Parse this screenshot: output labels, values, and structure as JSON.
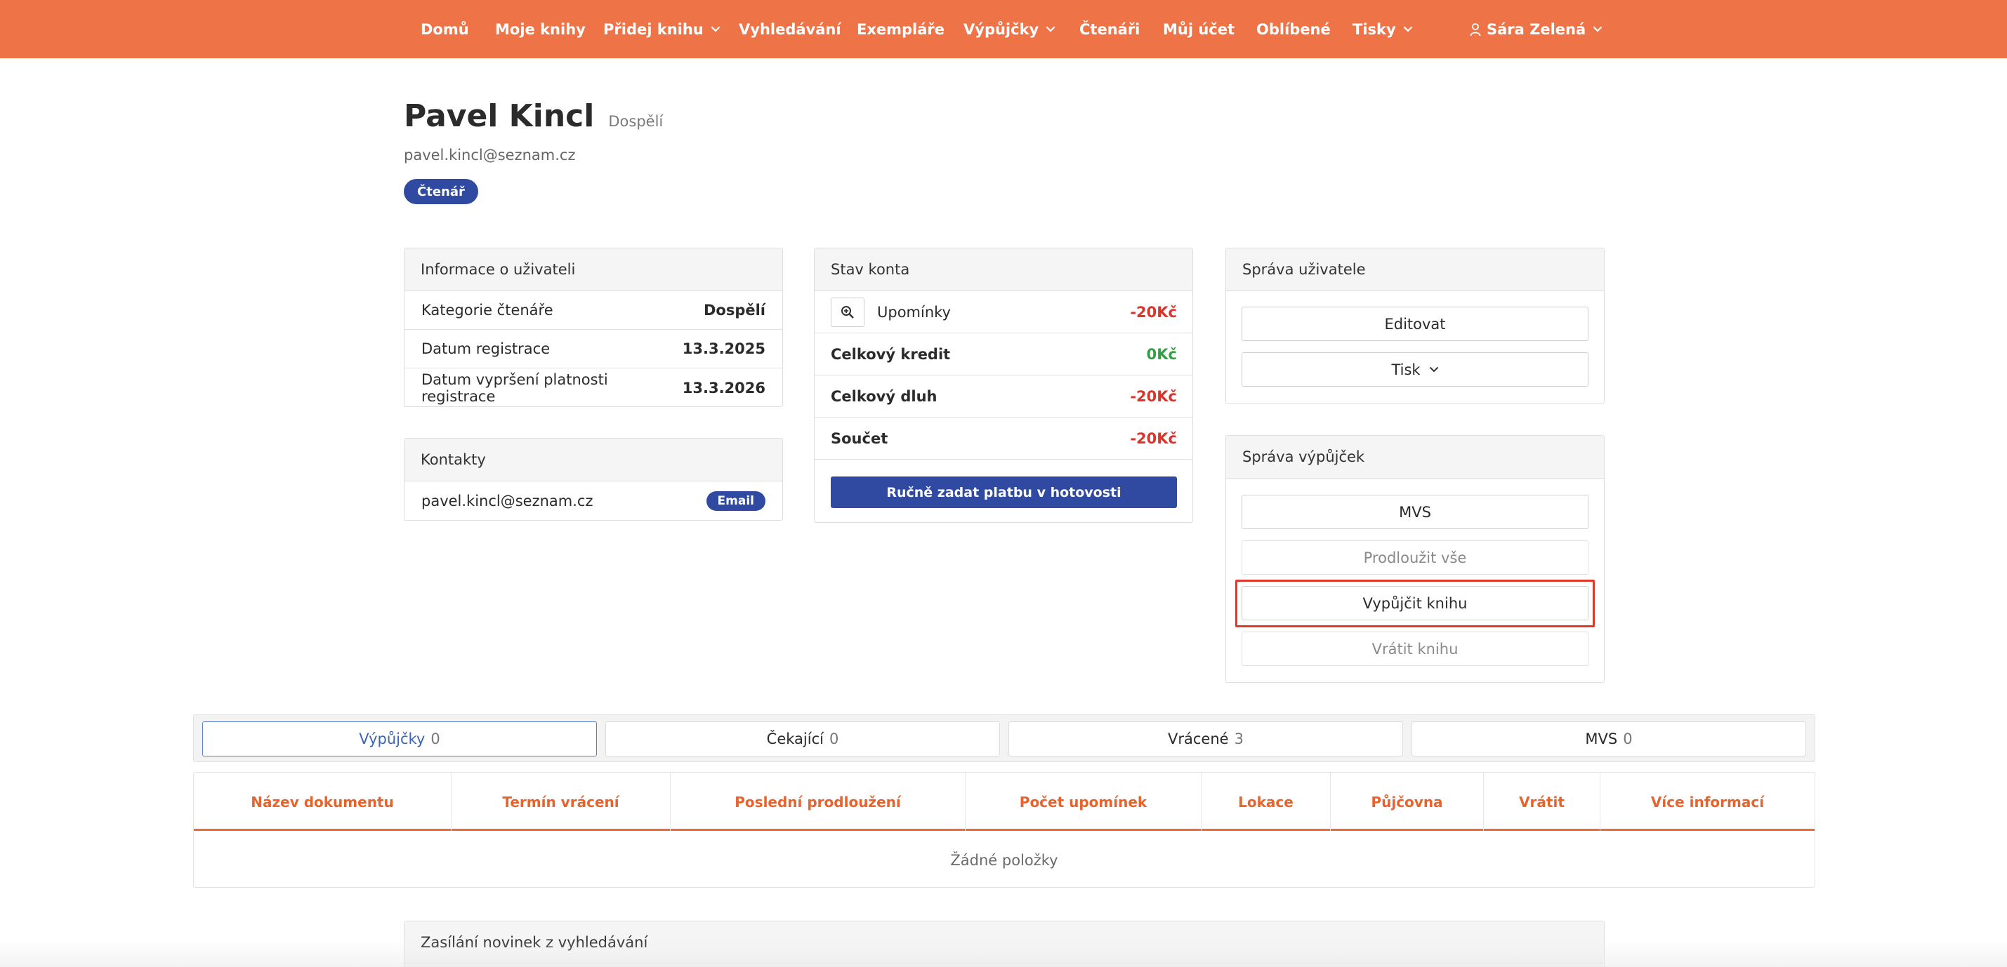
{
  "nav": {
    "items": [
      {
        "label": "Domů",
        "dropdown": false
      },
      {
        "label": "Moje knihy",
        "dropdown": false
      },
      {
        "label": "Přidej knihu",
        "dropdown": true
      },
      {
        "label": "Vyhledávání",
        "dropdown": false
      },
      {
        "label": "Exempláře",
        "dropdown": false
      },
      {
        "label": "Výpůjčky",
        "dropdown": true
      },
      {
        "label": "Čtenáři",
        "dropdown": false
      },
      {
        "label": "Můj účet",
        "dropdown": false
      },
      {
        "label": "Oblíbené",
        "dropdown": false
      },
      {
        "label": "Tisky",
        "dropdown": true
      }
    ],
    "user": "Sára Zelená",
    "color": "#ee7448"
  },
  "profile": {
    "name": "Pavel Kincl",
    "category": "Dospělí",
    "email": "pavel.kincl@seznam.cz",
    "role_badge": "Čtenář"
  },
  "user_info": {
    "title": "Informace o uživateli",
    "rows": [
      {
        "label": "Kategorie čtenáře",
        "value": "Dospělí"
      },
      {
        "label": "Datum registrace",
        "value": "13.3.2025"
      },
      {
        "label": "Datum vypršení platnosti registrace",
        "value": "13.3.2026"
      }
    ]
  },
  "contacts": {
    "title": "Kontakty",
    "email": "pavel.kincl@seznam.cz",
    "badge": "Email"
  },
  "account": {
    "title": "Stav konta",
    "reminders_label": "Upomínky",
    "reminders_value": "-20Kč",
    "credit_label": "Celkový kredit",
    "credit_value": "0Kč",
    "debt_label": "Celkový dluh",
    "debt_value": "-20Kč",
    "sum_label": "Součet",
    "sum_value": "-20Kč",
    "pay_button": "Ručně zadat platbu v hotovosti"
  },
  "user_admin": {
    "title": "Správa uživatele",
    "edit": "Editovat",
    "print": "Tisk"
  },
  "loans_admin": {
    "title": "Správa výpůjček",
    "mvs": "MVS",
    "extend_all": "Prodloužit vše",
    "borrow": "Vypůjčit knihu",
    "return": "Vrátit knihu"
  },
  "tabs": [
    {
      "label": "Výpůjčky",
      "count": "0",
      "active": true
    },
    {
      "label": "Čekající",
      "count": "0",
      "active": false
    },
    {
      "label": "Vrácené",
      "count": "3",
      "active": false
    },
    {
      "label": "MVS",
      "count": "0",
      "active": false
    }
  ],
  "table": {
    "columns": [
      "Název dokumentu",
      "Termín vrácení",
      "Poslední prodloužení",
      "Počet upomínek",
      "Lokace",
      "Půjčovna",
      "Vrátit",
      "Více informací"
    ],
    "empty": "Žádné položky"
  },
  "news": {
    "title": "Zasílání novinek z vyhledávání"
  }
}
